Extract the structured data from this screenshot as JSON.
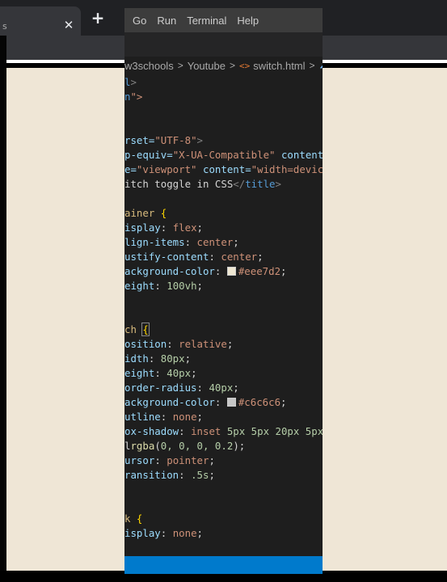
{
  "browser": {
    "tab_edge_char": "s",
    "close_tab_glyph": "✕",
    "new_tab_glyph": "+"
  },
  "editor": {
    "menu": [
      "Go",
      "Run",
      "Terminal",
      "Help"
    ],
    "breadcrumb": {
      "folder_1": "w3schools",
      "folder_2": "Youtube",
      "file": "switch.html",
      "separator": ">"
    },
    "colors": {
      "menubar": "#3c3c3c",
      "editor_bg": "#1e1e1e",
      "statusbar": "#007acc",
      "page_bg": "#efe6d6",
      "swatch_1": "#eee7d2",
      "swatch_2": "#c6c6c6"
    },
    "code_lines": [
      [
        [
          "l",
          "tagname"
        ],
        [
          ">",
          "tag"
        ]
      ],
      [
        [
          "n",
          "tagname"
        ],
        [
          "\">",
          "str"
        ]
      ],
      [],
      [],
      [
        [
          "rset=",
          "attr"
        ],
        [
          "\"UTF-8\"",
          "str"
        ],
        [
          ">",
          "tag"
        ]
      ],
      [
        [
          "p-equiv=",
          "attr"
        ],
        [
          "\"X-UA-Compatible\"",
          "str"
        ],
        [
          " content=",
          "attr"
        ]
      ],
      [
        [
          "e=",
          "attr"
        ],
        [
          "\"viewport\"",
          "str"
        ],
        [
          " content=",
          "attr"
        ],
        [
          "\"width=device",
          "str"
        ]
      ],
      [
        [
          "itch toggle in CSS",
          "text"
        ],
        [
          "</",
          "tag"
        ],
        [
          "title",
          "tagname"
        ],
        [
          ">",
          "tag"
        ]
      ],
      [],
      [
        [
          "ainer ",
          "sel"
        ],
        [
          "{",
          "brace"
        ]
      ],
      [
        [
          "isplay",
          "prop"
        ],
        [
          ": ",
          "text"
        ],
        [
          "flex",
          "val"
        ],
        [
          ";",
          "text"
        ]
      ],
      [
        [
          "lign-items",
          "prop"
        ],
        [
          ": ",
          "text"
        ],
        [
          "center",
          "val"
        ],
        [
          ";",
          "text"
        ]
      ],
      [
        [
          "ustify-content",
          "prop"
        ],
        [
          ": ",
          "text"
        ],
        [
          "center",
          "val"
        ],
        [
          ";",
          "text"
        ]
      ],
      [
        [
          "ackground-color",
          "prop"
        ],
        [
          ": ",
          "text"
        ],
        [
          "#eee7d2",
          "swatch1"
        ],
        [
          ";",
          "text"
        ]
      ],
      [
        [
          "eight",
          "prop"
        ],
        [
          ": ",
          "text"
        ],
        [
          "100vh",
          "num"
        ],
        [
          ";",
          "text"
        ]
      ],
      [],
      [],
      [
        [
          "ch ",
          "sel"
        ],
        [
          "{",
          "bracehl"
        ]
      ],
      [
        [
          "osition",
          "prop"
        ],
        [
          ": ",
          "text"
        ],
        [
          "relative",
          "val"
        ],
        [
          ";",
          "text"
        ]
      ],
      [
        [
          "idth",
          "prop"
        ],
        [
          ": ",
          "text"
        ],
        [
          "80px",
          "num"
        ],
        [
          ";",
          "text"
        ]
      ],
      [
        [
          "eight",
          "prop"
        ],
        [
          ": ",
          "text"
        ],
        [
          "40px",
          "num"
        ],
        [
          ";",
          "text"
        ]
      ],
      [
        [
          "order-radius",
          "prop"
        ],
        [
          ": ",
          "text"
        ],
        [
          "40px",
          "num"
        ],
        [
          ";",
          "text"
        ]
      ],
      [
        [
          "ackground-color",
          "prop"
        ],
        [
          ": ",
          "text"
        ],
        [
          "#c6c6c6",
          "swatch2"
        ],
        [
          ";",
          "text"
        ]
      ],
      [
        [
          "utline",
          "prop"
        ],
        [
          ": ",
          "text"
        ],
        [
          "none",
          "val"
        ],
        [
          ";",
          "text"
        ]
      ],
      [
        [
          "ox-shadow",
          "prop"
        ],
        [
          ": ",
          "text"
        ],
        [
          "inset ",
          "val"
        ],
        [
          "5px 5px 20px 5px",
          "num"
        ]
      ],
      [
        [
          "l",
          "text"
        ],
        [
          "rgba",
          "fn"
        ],
        [
          "(",
          "text"
        ],
        [
          "0, 0, 0, 0.2",
          "num"
        ],
        [
          ");",
          "text"
        ]
      ],
      [
        [
          "ursor",
          "prop"
        ],
        [
          ": ",
          "text"
        ],
        [
          "pointer",
          "val"
        ],
        [
          ";",
          "text"
        ]
      ],
      [
        [
          "ransition",
          "prop"
        ],
        [
          ": ",
          "text"
        ],
        [
          ".5s",
          "num"
        ],
        [
          ";",
          "text"
        ]
      ],
      [],
      [],
      [
        [
          "k ",
          "sel"
        ],
        [
          "{",
          "brace"
        ]
      ],
      [
        [
          "isplay",
          "prop"
        ],
        [
          ": ",
          "text"
        ],
        [
          "none",
          "val"
        ],
        [
          ";",
          "text"
        ]
      ]
    ]
  }
}
